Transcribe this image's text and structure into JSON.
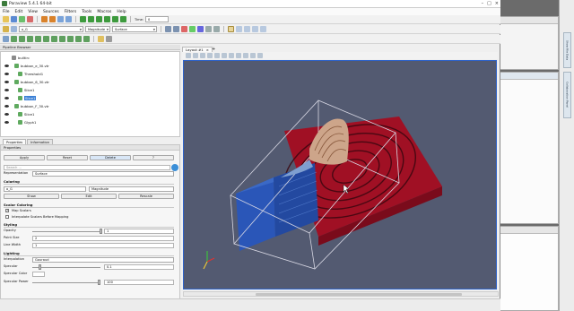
{
  "window": {
    "title": "Paraview 5.4.1 64-bit"
  },
  "menu": [
    "File",
    "Edit",
    "View",
    "Sources",
    "Filters",
    "Tools",
    "Macros",
    "Help"
  ],
  "toolbar": {
    "time_label": "Time:",
    "time_value": "0",
    "color_array": "o_G",
    "color_component": "Magnitude",
    "representation": "Surface"
  },
  "pipeline_browser": {
    "title": "Pipeline Browser",
    "items": [
      {
        "label": "builtin:",
        "visible": false,
        "selected": false
      },
      {
        "label": "bubbon_e_30.vtr",
        "visible": true,
        "selected": false
      },
      {
        "label": "Threshold1",
        "visible": true,
        "selected": false
      },
      {
        "label": "bubbon_6_30.vtr",
        "visible": true,
        "selected": false
      },
      {
        "label": "Slice1",
        "visible": true,
        "selected": false
      },
      {
        "label": "Slice1",
        "visible": true,
        "selected": true
      },
      {
        "label": "bubbon_F_30.vtr",
        "visible": true,
        "selected": false
      },
      {
        "label": "Slice1",
        "visible": true,
        "selected": false
      },
      {
        "label": "Glyph1",
        "visible": true,
        "selected": false
      }
    ]
  },
  "tabs": [
    "Properties",
    "Information"
  ],
  "properties": {
    "title": "Properties",
    "apply": "Apply",
    "reset": "Reset",
    "delete": "Delete",
    "help": "?",
    "search_placeholder": "Search ...",
    "representation_label": "Representation",
    "representation_value": "Surface",
    "coloring_title": "Coloring",
    "coloring_array": "o_G",
    "coloring_component": "Magnitude",
    "show_label": "Show",
    "edit_label": "Edit",
    "rescale_label": "Rescale",
    "scalar_coloring_title": "Scalar Coloring",
    "map_scalars": "Map Scalars",
    "interpolate": "Interpolate Scalars Before Mapping",
    "styling_title": "Styling",
    "opacity_label": "Opacity",
    "opacity_value": "1",
    "point_size_label": "Point Size",
    "point_size_value": "2",
    "line_width_label": "Line Width",
    "line_width_value": "1",
    "lighting_title": "Lighting",
    "interpolation_label": "Interpolation",
    "interpolation_value": "Gouraud",
    "specular_label": "Specular",
    "specular_value": "0.1",
    "specular_color_label": "Specular Color",
    "specular_power_label": "Specular Power",
    "specular_power_value": "100"
  },
  "view": {
    "tab_label": "Layout #1",
    "close": "×",
    "add": "+"
  },
  "right_tabs": [
    "Show File Data",
    "Collaboration Panel"
  ],
  "colors": {
    "viewport_bg": "#535a71",
    "red_plate": "#a01024",
    "blue_box": "#2a56b8",
    "selection": "#3a7fd5"
  }
}
